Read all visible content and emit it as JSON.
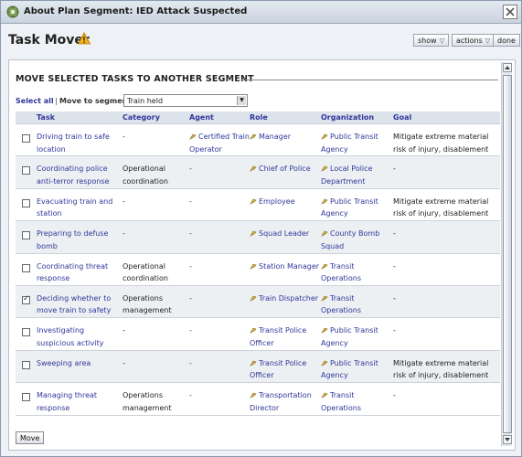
{
  "window": {
    "title": "About Plan Segment: IED Attack Suspected"
  },
  "header": {
    "page_title": "Task Mover",
    "show_label": "show",
    "actions_label": "actions",
    "done_label": "done"
  },
  "section": {
    "title": "MOVE SELECTED TASKS TO ANOTHER SEGMENT",
    "select_all": "Select all",
    "separator": "|",
    "move_to_label": "Move to segment",
    "segment_selected": "Train held"
  },
  "table": {
    "columns": {
      "task": "Task",
      "category": "Category",
      "agent": "Agent",
      "role": "Role",
      "organization": "Organization",
      "goal": "Goal"
    },
    "rows": [
      {
        "checked": false,
        "task": "Driving train to safe location",
        "category": "-",
        "agent": "Certified Train Operator",
        "role": "Manager",
        "organization": "Public Transit Agency",
        "goal": "Mitigate extreme material risk of injury, disablement or death"
      },
      {
        "checked": false,
        "task": "Coordinating police anti-terror response",
        "category": "Operational coordination",
        "agent": "-",
        "role": "Chief of Police",
        "organization": "Local Police Department",
        "goal": "-"
      },
      {
        "checked": false,
        "task": "Evacuating train and station",
        "category": "-",
        "agent": "-",
        "role": "Employee",
        "organization": "Public Transit Agency",
        "goal": "Mitigate extreme material risk of injury, disablement or death"
      },
      {
        "checked": false,
        "task": "Preparing to defuse bomb",
        "category": "-",
        "agent": "-",
        "role": "Squad Leader",
        "organization": "County Bomb Squad",
        "goal": "-"
      },
      {
        "checked": false,
        "task": "Coordinating threat response",
        "category": "Operational coordination",
        "agent": "-",
        "role": "Station Manager",
        "organization": "Transit Operations",
        "goal": "-"
      },
      {
        "checked": true,
        "task": "Deciding whether to move train to safety",
        "category": "Operations management",
        "agent": "-",
        "role": "Train Dispatcher",
        "organization": "Transit Operations",
        "goal": "-"
      },
      {
        "checked": false,
        "task": "Investigating suspicious activity",
        "category": "-",
        "agent": "-",
        "role": "Transit Police Officer",
        "organization": "Public Transit Agency",
        "goal": "-"
      },
      {
        "checked": false,
        "task": "Sweeping area",
        "category": "-",
        "agent": "-",
        "role": "Transit Police Officer",
        "organization": "Public Transit Agency",
        "goal": "Mitigate extreme material risk of injury, disablement or death"
      },
      {
        "checked": false,
        "task": "Managing threat response",
        "category": "Operations management",
        "agent": "-",
        "role": "Transportation Director",
        "organization": "Transit Operations",
        "goal": "-"
      }
    ]
  },
  "footer": {
    "move_label": "Move"
  },
  "icons": {
    "app": "gear-icon",
    "warning": "warning-icon",
    "close": "close-icon",
    "entity": "pin-icon"
  },
  "colors": {
    "link": "#30369a",
    "header_bg": "#dde3ea",
    "row_alt": "#edf0f3"
  }
}
